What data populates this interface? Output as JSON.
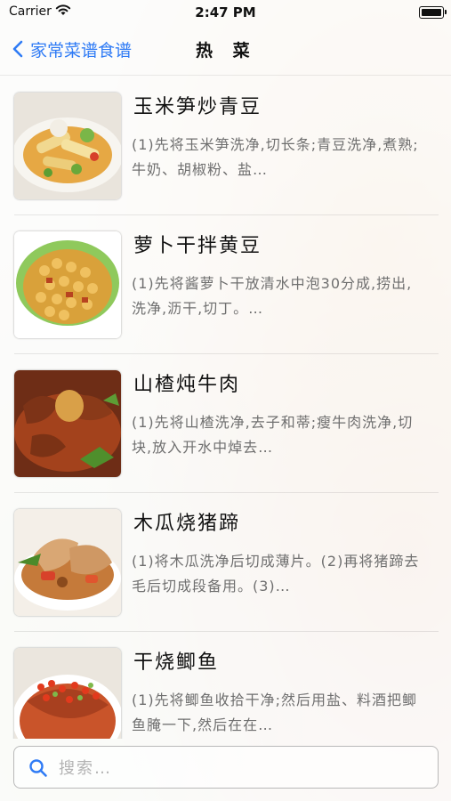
{
  "status_bar": {
    "carrier": "Carrier",
    "time": "2:47 PM"
  },
  "nav": {
    "back_label": "家常菜谱食谱",
    "title": "热 菜"
  },
  "accent_color": "#2f7bf5",
  "recipes": [
    {
      "title": "玉米笋炒青豆",
      "description": "(1)先将玉米笋洗净,切长条;青豆洗净,煮熟;牛奶、胡椒粉、盐…"
    },
    {
      "title": "萝卜干拌黄豆",
      "description": "(1)先将酱萝卜干放清水中泡30分成,捞出,洗净,沥干,切丁。…"
    },
    {
      "title": "山楂炖牛肉",
      "description": "(1)先将山楂洗净,去子和蒂;瘦牛肉洗净,切块,放入开水中焯去…"
    },
    {
      "title": "木瓜烧猪蹄",
      "description": "(1)将木瓜洗净后切成薄片。(2)再将猪蹄去毛后切成段备用。(3)…"
    },
    {
      "title": "干烧鲫鱼",
      "description": "(1)先将鲫鱼收拾干净;然后用盐、料酒把鲫鱼腌一下,然后在在…"
    }
  ],
  "search": {
    "placeholder": "搜索…",
    "value": ""
  }
}
